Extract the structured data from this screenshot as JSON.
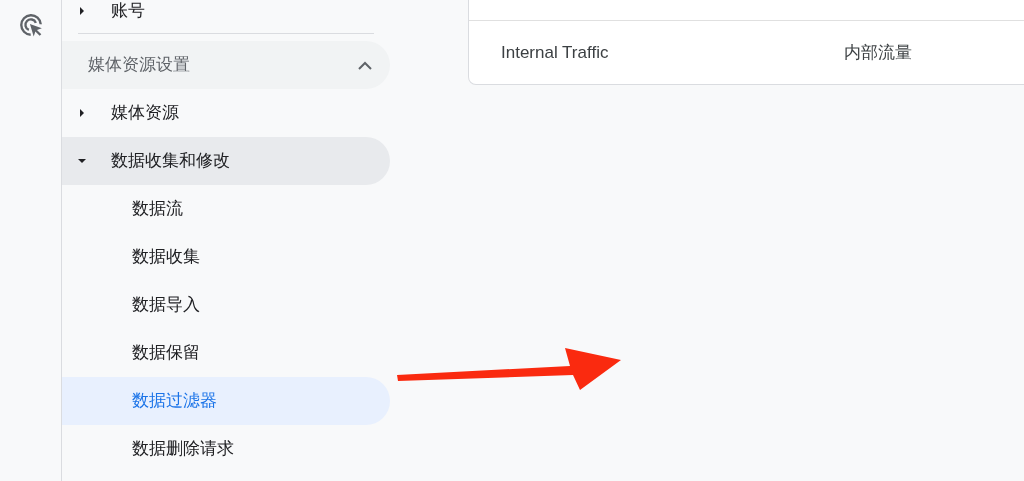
{
  "nav": {
    "top_items": [
      {
        "label": "账号",
        "expanded": false
      }
    ],
    "section": {
      "title": "媒体资源设置",
      "expanded": true,
      "items": [
        {
          "label": "媒体资源",
          "expanded": false
        },
        {
          "label": "数据收集和修改",
          "expanded": true,
          "children": [
            {
              "label": "数据流",
              "selected": false
            },
            {
              "label": "数据收集",
              "selected": false
            },
            {
              "label": "数据导入",
              "selected": false
            },
            {
              "label": "数据保留",
              "selected": false
            },
            {
              "label": "数据过滤器",
              "selected": true
            },
            {
              "label": "数据删除请求",
              "selected": false
            }
          ]
        }
      ]
    }
  },
  "table": {
    "rows": [
      {
        "column_1": "Internal Traffic",
        "column_2": "内部流量"
      }
    ]
  }
}
